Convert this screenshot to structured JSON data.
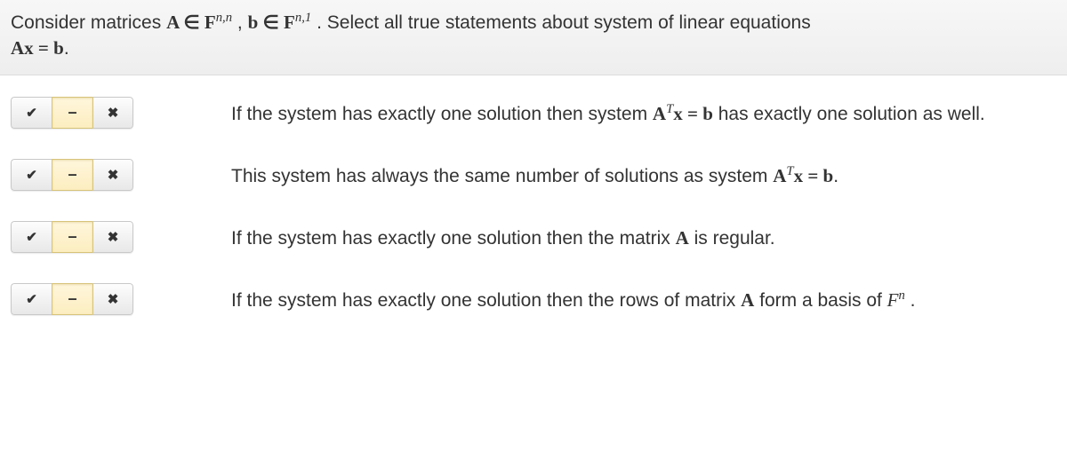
{
  "question": {
    "prefix": "Consider matrices ",
    "matA": "A ∈ F",
    "supA": "n,n",
    "sep": " , ",
    "vecb": "b ∈ F",
    "supb": "n,1",
    "after": " . Select all true statements about system of linear equations",
    "eq_lhs": "Ax = b",
    "eq_end": "."
  },
  "toggle": {
    "check": "✔",
    "dash": "–",
    "cross": "✖"
  },
  "answers": [
    {
      "pre": "If the system has exactly one solution then system ",
      "math_main": "A",
      "math_sup": "T",
      "math_rest": "x = b",
      "post": " has exactly one solution as well.",
      "selected": "dash"
    },
    {
      "pre": "This system has always the same number of solutions as system ",
      "math_main": "A",
      "math_sup": "T",
      "math_rest": "x = b",
      "post": ".",
      "selected": "dash"
    },
    {
      "pre": "If the system has exactly one solution then the matrix ",
      "math_main": "A",
      "math_sup": "",
      "math_rest": "",
      "post": " is regular.",
      "selected": "dash"
    },
    {
      "pre": "If the system has exactly one solution then the rows of matrix ",
      "math_main": "A",
      "math_sup": "",
      "math_rest": "",
      "post": " form a basis of ",
      "post_math_main": "F",
      "post_math_sup": "n",
      "post2": " .",
      "selected": "dash"
    }
  ]
}
